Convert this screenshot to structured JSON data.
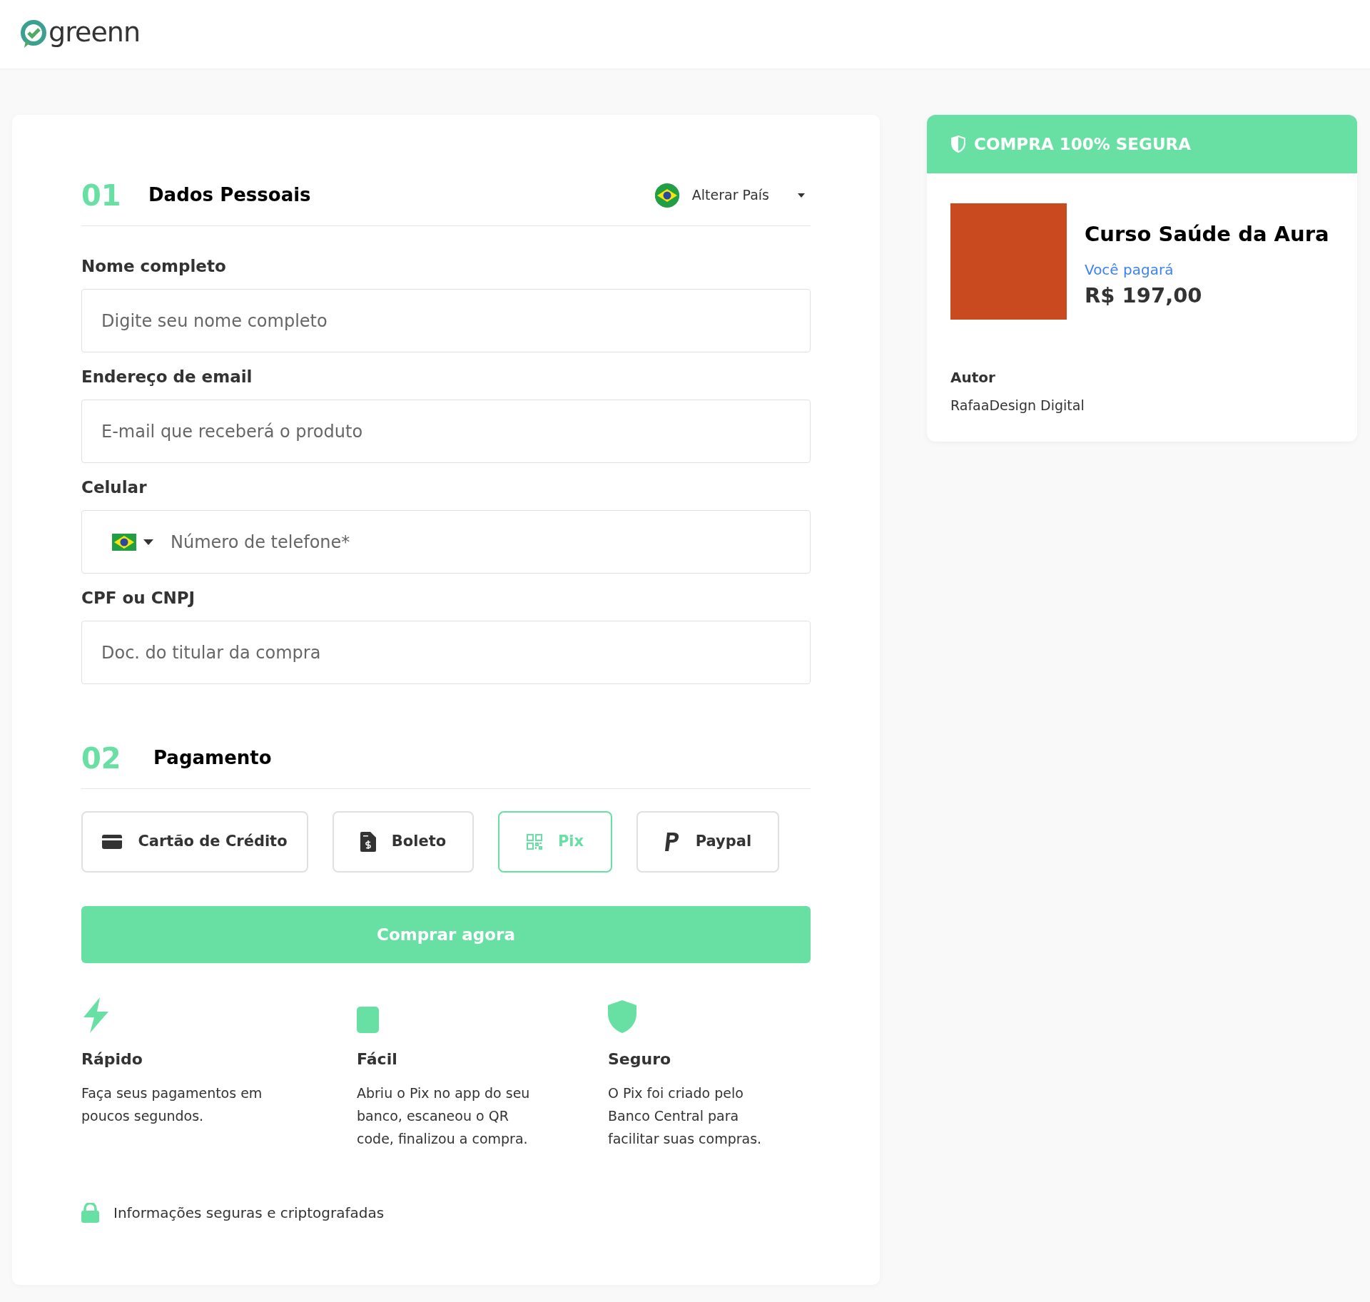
{
  "header": {
    "logo_text": "greenn"
  },
  "personal": {
    "number": "01",
    "title": "Dados Pessoais",
    "country_button": "Alterar País",
    "fields": [
      {
        "kind": "text",
        "label": "Nome completo",
        "placeholder": "Digite seu nome completo"
      },
      {
        "kind": "text",
        "label": "Endereço de email",
        "placeholder": "E-mail que receberá o produto"
      },
      {
        "kind": "phone",
        "label": "Celular",
        "placeholder": "Número de telefone*"
      },
      {
        "kind": "text",
        "label": "CPF ou CNPJ",
        "placeholder": "Doc. do titular da compra"
      }
    ]
  },
  "payment": {
    "number": "02",
    "title": "Pagamento",
    "methods": [
      {
        "kind": "card",
        "label": "Cartão de Crédito",
        "selected": false
      },
      {
        "kind": "boleto",
        "label": "Boleto",
        "selected": false
      },
      {
        "kind": "pix",
        "label": "Pix",
        "selected": true
      },
      {
        "kind": "paypal",
        "label": "Paypal",
        "selected": false
      }
    ],
    "submit": "Comprar agora",
    "features": [
      {
        "kind": "bolt",
        "title": "Rápido",
        "text": "Faça seus pagamentos em poucos segundos."
      },
      {
        "kind": "square",
        "title": "Fácil",
        "text": "Abriu o Pix no app do seu banco, escaneou o QR code, finalizou a compra."
      },
      {
        "kind": "shield",
        "title": "Seguro",
        "text": "O Pix foi criado pelo Banco Central para facilitar suas compras."
      }
    ],
    "secure_note": "Informações seguras e criptografadas"
  },
  "summary": {
    "banner": "COMPRA 100% SEGURA",
    "product_title": "Curso Saúde da Aura",
    "pay_label": "Você pagará",
    "price": "R$ 197,00",
    "author_label": "Autor",
    "author": "RafaaDesign Digital"
  }
}
